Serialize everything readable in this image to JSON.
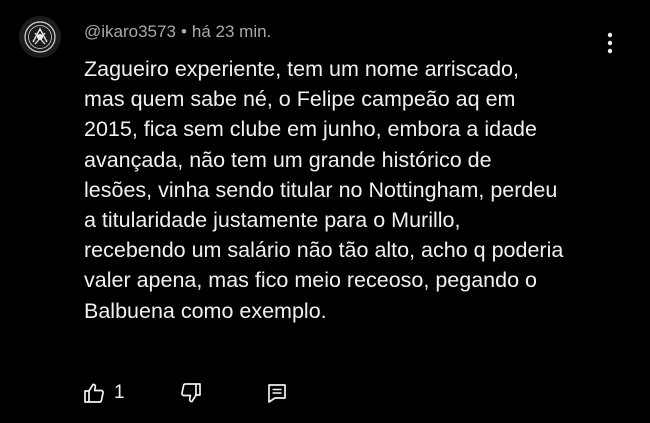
{
  "comment": {
    "author": "@ikaro3573",
    "separator": "•",
    "time": "há 23 min.",
    "lines": [
      "Zagueiro experiente, tem um nome arriscado,",
      "mas quem sabe né, o Felipe campeão aq em",
      "2015, fica sem clube em junho, embora a idade",
      "avançada, não tem um grande histórico de",
      "lesões, vinha sendo titular no Nottingham, perdeu",
      "a titularidade justamente para o Murillo,",
      "recebendo um salário não tão alto, acho q poderia",
      "valer apena, mas fico meio receoso, pegando o",
      "Balbuena como exemplo."
    ],
    "like_count": "1"
  },
  "icons": {
    "avatar": "corinthians-crest-icon",
    "menu": "more-vertical-icon",
    "like": "thumbs-up-icon",
    "dislike": "thumbs-down-icon",
    "reply": "reply-comment-icon"
  },
  "colors": {
    "background": "#000000",
    "text": "#f1f1f1",
    "meta": "#aaaaaa"
  }
}
